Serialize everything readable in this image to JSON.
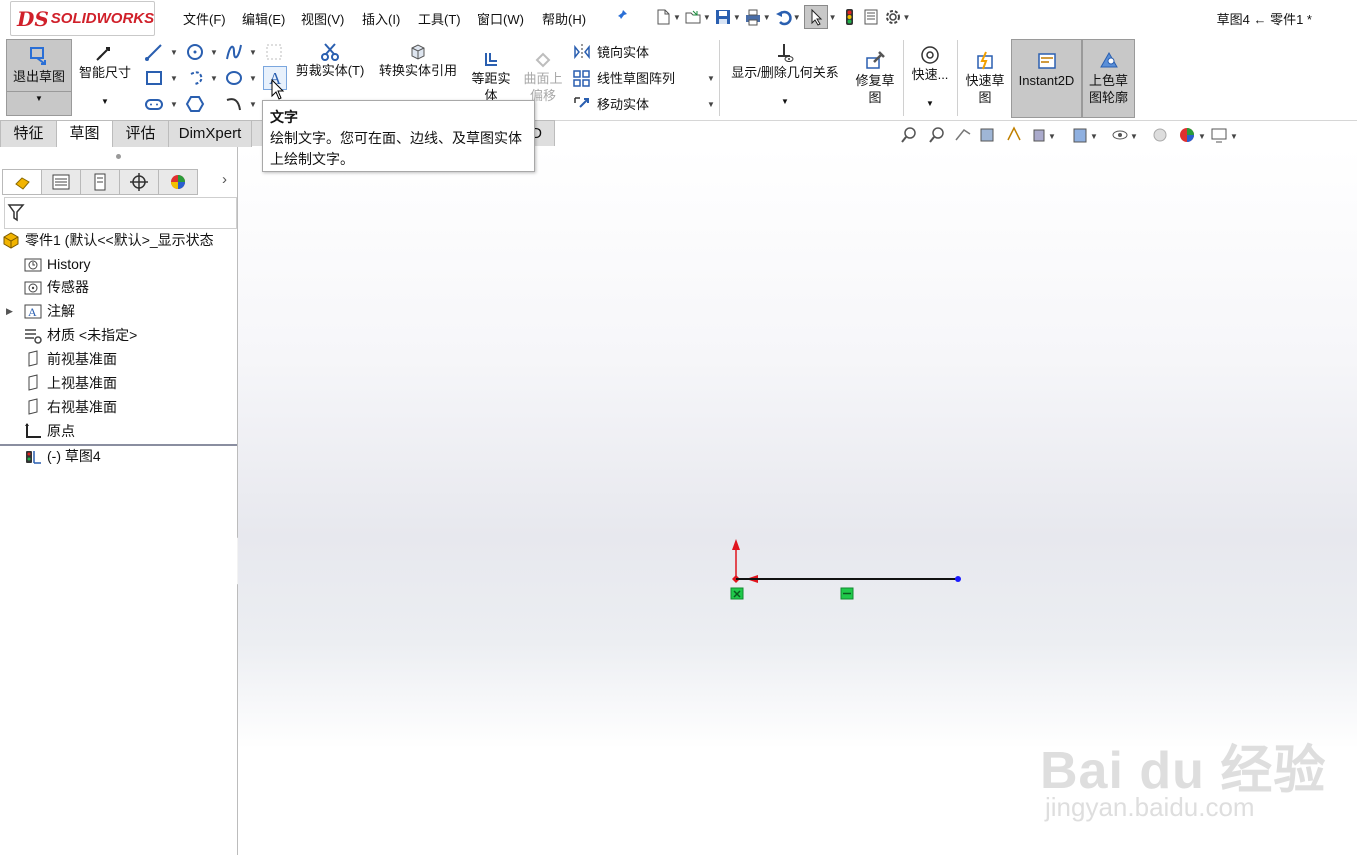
{
  "logo": {
    "mark": "DS",
    "text": "SOLIDWORKS"
  },
  "menu": [
    "文件(F)",
    "编辑(E)",
    "视图(V)",
    "插入(I)",
    "工具(T)",
    "窗口(W)",
    "帮助(H)"
  ],
  "document_title": "草图4 ← 零件1 *",
  "command_manager": {
    "exit_sketch": "退出草图",
    "smart_dimension": "智能尺寸",
    "trim_entities": "剪裁实体(T)",
    "convert_entities": "转换实体引用",
    "offset_entities": "等距实体",
    "offset_on_surface": "曲面上偏移",
    "mirror_entities": "镜向实体",
    "linear_pattern": "线性草图阵列",
    "move_entities": "移动实体",
    "display_delete_relations": "显示/删除几何关系",
    "repair_sketch": "修复草图",
    "quick_snaps": "快速...",
    "rapid_sketch": "快速草图",
    "instant2d": "Instant2D",
    "shaded_sketch_contours": "上色草图轮廓"
  },
  "tabs": [
    "特征",
    "草图",
    "评估",
    "DimXpert",
    "D"
  ],
  "active_tab": "草图",
  "tooltip": {
    "title": "文字",
    "body": "绘制文字。您可在面、边线、及草图实体上绘制文字。"
  },
  "feature_tree": {
    "root": "零件1  (默认<<默认>_显示状态",
    "items": [
      {
        "label": "History",
        "icon": "history-folder-icon"
      },
      {
        "label": "传感器",
        "icon": "sensor-icon"
      },
      {
        "label": "注解",
        "icon": "annotation-icon"
      },
      {
        "label": "材质 <未指定>",
        "icon": "material-icon"
      },
      {
        "label": "前视基准面",
        "icon": "plane-icon"
      },
      {
        "label": "上视基准面",
        "icon": "plane-icon"
      },
      {
        "label": "右视基准面",
        "icon": "plane-icon"
      },
      {
        "label": "原点",
        "icon": "origin-icon"
      },
      {
        "label": "(-) 草图4",
        "icon": "sketch-icon"
      }
    ]
  },
  "watermark": {
    "main": "Bai du 经验",
    "sub": "jingyan.baidu.com"
  },
  "colors": {
    "sketch_line": "#111111",
    "endpoint": "#1a1aff",
    "origin_arrow": "#e0141e",
    "relation_badge": "#1fc94a"
  }
}
